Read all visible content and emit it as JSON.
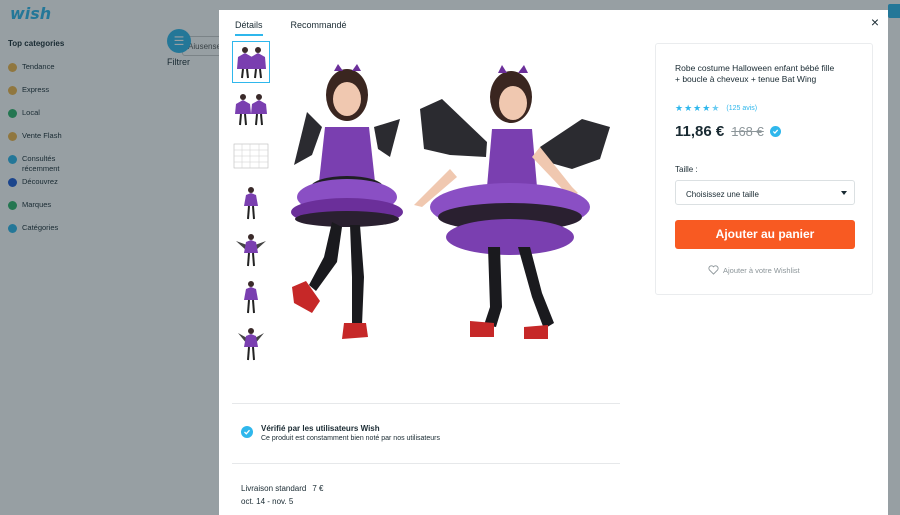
{
  "background": {
    "logo": "wish",
    "sidebar_title": "Top categories",
    "categories": [
      {
        "label": "Tendance",
        "color": "#f3b64a"
      },
      {
        "label": "Express",
        "color": "#f3b64a"
      },
      {
        "label": "Local",
        "color": "#2fb56a"
      },
      {
        "label": "Vente Flash",
        "color": "#f3b64a"
      },
      {
        "label": "Consultés récemment",
        "color": "#2fb7ec"
      },
      {
        "label": "Découvrez",
        "color": "#1e5bd6"
      },
      {
        "label": "Marques",
        "color": "#2fb56a"
      },
      {
        "label": "Catégories",
        "color": "#2fb7ec"
      }
    ],
    "filter_label": "Filtrer",
    "search_fragment": "Aiusense"
  },
  "modal": {
    "tabs": [
      {
        "label": "Détails",
        "active": true
      },
      {
        "label": "Recommandé",
        "active": false
      }
    ],
    "close_label": "×",
    "verified": {
      "title": "Vérifié par les utilisateurs Wish",
      "desc": "Ce produit est constamment bien noté par nos utilisateurs"
    },
    "shipping": {
      "title": "Livraison standard",
      "price": "7 €",
      "dates": "oct. 14 - nov. 5"
    }
  },
  "product": {
    "title": "Robe costume Halloween enfant bébé fille + boucle à cheveux + tenue Bat Wing",
    "rating": 4.5,
    "reviews": "(125 avis)",
    "price": "11,86 €",
    "old_price": "168 €",
    "size_label": "Taille :",
    "size_placeholder": "Choisissez une taille",
    "add_to_cart": "Ajouter au panier",
    "wishlist": "Ajouter à votre Wishlist"
  },
  "colors": {
    "accent": "#2fb7ec",
    "cart_button": "#f85a22",
    "dress_purple": "#7a3fb0",
    "text": "#192a32"
  }
}
